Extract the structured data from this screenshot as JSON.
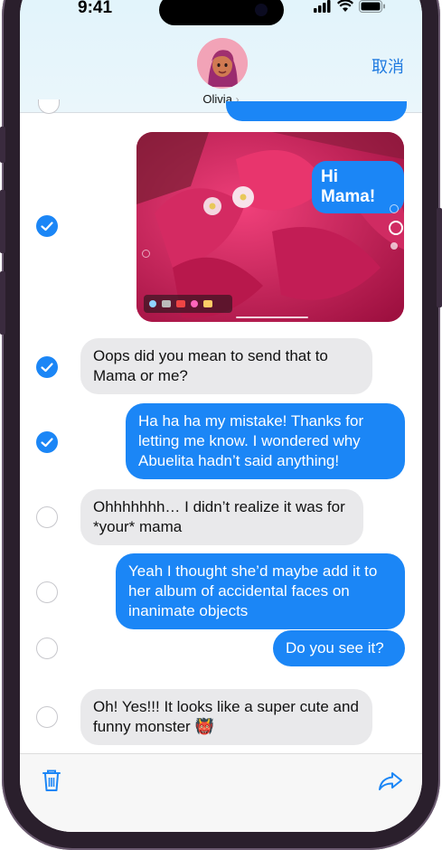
{
  "status": {
    "time": "9:41"
  },
  "header": {
    "contact_name": "Olivia",
    "chevron": "›",
    "cancel_label": "取消"
  },
  "photo_message": {
    "sticker_text": "Hi Mama!"
  },
  "messages": [
    {
      "text": "Oops did you mean to send that to Mama or me?"
    },
    {
      "text": "Ha ha ha my mistake! Thanks for letting me know. I wondered why Abuelita hadn’t said anything!"
    },
    {
      "text": "Ohhhhhhh… I didn’t realize it was for *your* mama"
    },
    {
      "text": "Yeah I thought she’d maybe add it to her album of accidental faces on inanimate objects"
    },
    {
      "text": "Do you see it?"
    },
    {
      "text": "Oh! Yes!!! It looks like a super cute and funny monster 👹"
    }
  ],
  "selection": {
    "photo": true,
    "m0": true,
    "m1": true,
    "m2": false,
    "m3": false,
    "m4": false,
    "m5": false
  },
  "toolbar": {
    "delete_icon": "trash-icon",
    "forward_icon": "share-arrow-icon"
  },
  "colors": {
    "blue": "#1b86f6",
    "gray_bubble": "#e9e9eb",
    "accent": "#1f7ae0"
  }
}
